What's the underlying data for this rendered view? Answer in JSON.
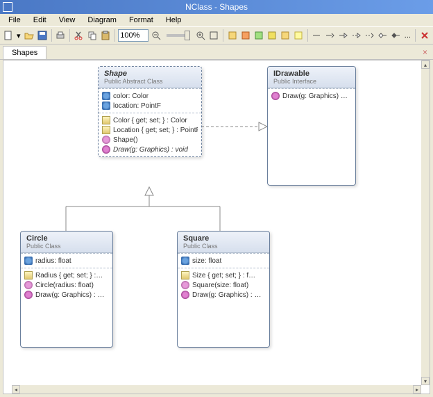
{
  "title": "NClass - Shapes",
  "menu": {
    "file": "File",
    "edit": "Edit",
    "view": "View",
    "diagram": "Diagram",
    "format": "Format",
    "help": "Help"
  },
  "toolbar": {
    "zoom": "100%"
  },
  "tabs": {
    "active": "Shapes"
  },
  "diagram": {
    "shape": {
      "name": "Shape",
      "stereo": "Public Abstract Class",
      "fields": [
        {
          "text": "color: Color",
          "kind": "field"
        },
        {
          "text": "location: PointF",
          "kind": "field"
        }
      ],
      "ops": [
        {
          "text": "Color { get; set; } : Color",
          "kind": "prop"
        },
        {
          "text": "Location { get; set; } : PointF",
          "kind": "prop"
        },
        {
          "text": "Shape()",
          "kind": "ctor"
        },
        {
          "text": "Draw(g: Graphics) : void",
          "kind": "method",
          "abstract": true
        }
      ]
    },
    "idrawable": {
      "name": "IDrawable",
      "stereo": "Public Interface",
      "ops": [
        {
          "text": "Draw(g: Graphics) …",
          "kind": "method"
        }
      ]
    },
    "circle": {
      "name": "Circle",
      "stereo": "Public Class",
      "fields": [
        {
          "text": "radius: float",
          "kind": "field"
        }
      ],
      "ops": [
        {
          "text": "Radius { get; set; } :…",
          "kind": "prop"
        },
        {
          "text": "Circle(radius: float)",
          "kind": "ctor"
        },
        {
          "text": "Draw(g: Graphics) : …",
          "kind": "method"
        }
      ]
    },
    "square": {
      "name": "Square",
      "stereo": "Public Class",
      "fields": [
        {
          "text": "size: float",
          "kind": "field"
        }
      ],
      "ops": [
        {
          "text": "Size { get; set; } : f…",
          "kind": "prop"
        },
        {
          "text": "Square(size: float)",
          "kind": "ctor"
        },
        {
          "text": "Draw(g: Graphics) : …",
          "kind": "method"
        }
      ]
    }
  }
}
